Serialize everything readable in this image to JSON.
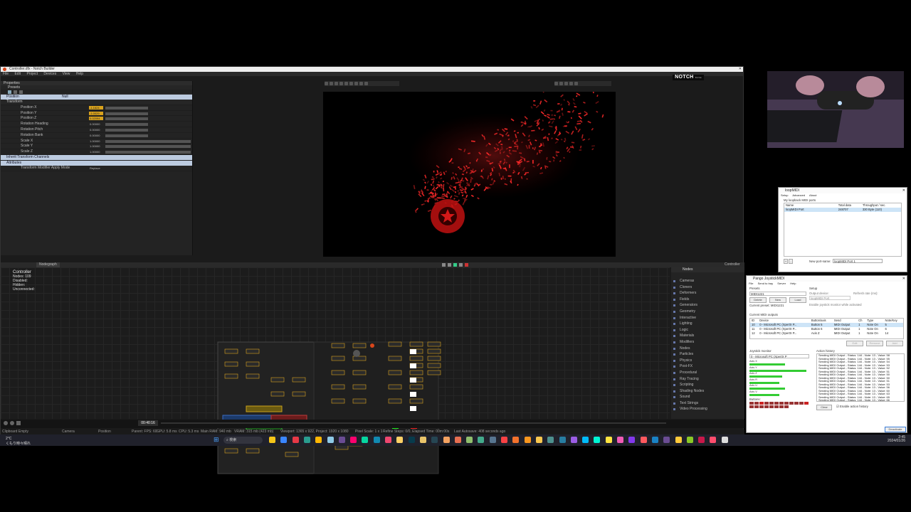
{
  "notch": {
    "title": "Controller.dfx - Notch Builder",
    "brand": "NOTCH",
    "edition": "BASE",
    "menu": [
      "File",
      "Edit",
      "Project",
      "Devices",
      "View",
      "Help"
    ],
    "properties_title": "Properties",
    "presets_label": "Presets",
    "header_row": {
      "label": "Position",
      "value": "Null"
    },
    "transform_label": "Transform",
    "rows": [
      {
        "label": "Position X",
        "value": "-1.1624",
        "highlight": true
      },
      {
        "label": "Position Y",
        "value": "-1.0029",
        "highlight": true
      },
      {
        "label": "Position Z",
        "value": "0.02094",
        "highlight": true
      },
      {
        "label": "Rotation Heading",
        "value": "0.00000",
        "highlight": false
      },
      {
        "label": "Rotation Pitch",
        "value": "0.00000",
        "highlight": false
      },
      {
        "label": "Rotation Bank",
        "value": "0.00000",
        "highlight": false
      },
      {
        "label": "Scale X",
        "value": "1.00000",
        "highlight": false
      },
      {
        "label": "Scale Y",
        "value": "1.00000",
        "highlight": false
      },
      {
        "label": "Scale Z",
        "value": "1.00000",
        "highlight": false
      }
    ],
    "inherit_label": "Inherit Transform Channels",
    "attributes_label": "Attributes",
    "apply_mode": {
      "label": "Transform Modifier Apply Mode",
      "value": "Replace"
    },
    "nodegraph_tab": "Nodegraph",
    "controller_tab": "Controller",
    "controller_info": {
      "title": "Controller",
      "nodes": "Nodes: 109",
      "disabled": "Disabled:",
      "hidden": "Hidden:",
      "unconnected": "Unconnected:"
    },
    "nodes_tab": "Nodes",
    "node_categories": [
      "Cameras",
      "Cloners",
      "Deformers",
      "Fields",
      "Generators",
      "Geometry",
      "Interactive",
      "Lighting",
      "Logic",
      "Materials",
      "Modifiers",
      "Nodes",
      "Particles",
      "Physics",
      "Post-FX",
      "Procedural",
      "Ray Tracing",
      "Scripting",
      "Shading Nodes",
      "Sound",
      "Text Strings",
      "Video Processing"
    ],
    "timecode": "00:40:16",
    "status": {
      "clipboard": "Clipboard Empty",
      "camera": "Camera",
      "position": "Position",
      "parent": "Parent: FPS: 60",
      "gpu": "GPU: 5.8 ms",
      "cpu": "CPU: 5.3 ms",
      "ram": "Main RAM: 940 mb",
      "vram": "VRAM: 315 mb (423 mb)",
      "viewport": "Viewport: 1365 x 922, Project: 1920 x 1080",
      "pixel_scale": "Pixel Scale: 1 x 1",
      "refine": "Refine Steps: 0/0, Elapsed Time: 00m:00s",
      "autosave": "Last Autosave: 408 seconds ago"
    }
  },
  "loopmidi": {
    "title": "loopMIDI",
    "tabs": [
      "Setup",
      "Advanced",
      "About"
    ],
    "section": "My loopback MIDI ports",
    "columns": [
      "Name",
      "Total data",
      "Throughput / sec."
    ],
    "rows": [
      {
        "name": "loopMIDI Port",
        "total": "248707",
        "throughput": "330 Byte (110)"
      }
    ],
    "new_port_label": "New port-name:",
    "new_port_value": "loopMIDI Port 1",
    "buttons": [
      "+",
      "-"
    ]
  },
  "pango": {
    "title": "Pango JoystickMIDI",
    "menu": [
      "File",
      "Send to tray",
      "Server",
      "Help"
    ],
    "presets_label": "Presets",
    "presets_value": "MIDI1221",
    "delete": "Delete",
    "new": "New",
    "load": "Load",
    "current_preset": "Current preset: MIDI1221",
    "setup_label": "Setup",
    "output_device_label": "Output device:",
    "output_device": "loopMIDI Port",
    "refresh_label": "Refresh rate (ms):",
    "enable_monitor": "Enable joystick monitor while activated",
    "outputs_label": "Current MIDI outputs",
    "out_columns": [
      "ID",
      "Device",
      "Button/axis",
      "Send",
      "Ch",
      "Type",
      "Note/Key"
    ],
    "out_rows": [
      [
        "10",
        "0 - Microsoft PC (XpertX P...",
        "Button 5",
        "MIDI Output",
        "1",
        "Note On",
        "5"
      ],
      [
        "11",
        "0 - Microsoft PC (XpertX P...",
        "Button 6",
        "MIDI Output",
        "1",
        "Note On",
        "6"
      ],
      [
        "12",
        "0 - Microsoft PC (XpertX P...",
        "Axis Z",
        "MIDI Output",
        "1",
        "Note On",
        "14"
      ]
    ],
    "edit": "Edit",
    "remove": "Remove",
    "add": "Add",
    "joystick_label": "Joystick monitor",
    "joystick_value": "0 - Microsoft PC (XpertX P",
    "axes": [
      {
        "label": "Axis X",
        "level": 0.6
      },
      {
        "label": "Axis Y",
        "level": 0.95
      },
      {
        "label": "Axis Z",
        "level": 0.55
      },
      {
        "label": "Axis R",
        "level": 0.5
      },
      {
        "label": "Axis U",
        "level": 0.6
      },
      {
        "label": "Axis V",
        "level": 0.5
      }
    ],
    "buttons_label": "Buttons:",
    "history_label": "Action history",
    "history": [
      "Sending MIDI Output - Status: 144 - Note: 13 - Value: 58",
      "Sending MIDI Output - Status: 144 - Note: 13 - Value: 55",
      "Sending MIDI Output - Status: 144 - Note: 13 - Value: 54",
      "Sending MIDI Output - Status: 144 - Note: 13 - Value: 53",
      "Sending MIDI Output - Status: 144 - Note: 13 - Value: 52",
      "Sending MIDI Output - Status: 144 - Note: 13 - Value: 51",
      "Sending MIDI Output - Status: 144 - Note: 13 - Value: 50",
      "Sending MIDI Output - Status: 144 - Note: 13 - Value: 50",
      "Sending MIDI Output - Status: 144 - Note: 13 - Value: 51",
      "Sending MIDI Output - Status: 144 - Note: 13 - Value: 53",
      "Sending MIDI Output - Status: 144 - Note: 13 - Value: 56",
      "Sending MIDI Output - Status: 144 - Note: 13 - Value: 60",
      "Sending MIDI Output - Status: 144 - Note: 13 - Value: 63",
      "Sending MIDI Output - Status: 144 - Note: 13 - Value: 65",
      "Sending MIDI Output - Status: 144 - Note: 13 - Value: 66"
    ],
    "clear": "Clear",
    "enable_history": "Enable action history",
    "deactivate": "Deactivate"
  },
  "taskbar": {
    "weather": "2°C",
    "weather_sub": "くもり時々晴れ",
    "search": "検索",
    "time": "2:45",
    "date": "2024/01/26"
  },
  "colors": {
    "accent_orange": "#d9a21c",
    "notch_red": "#d8461b",
    "selection": "#cde4f7"
  }
}
